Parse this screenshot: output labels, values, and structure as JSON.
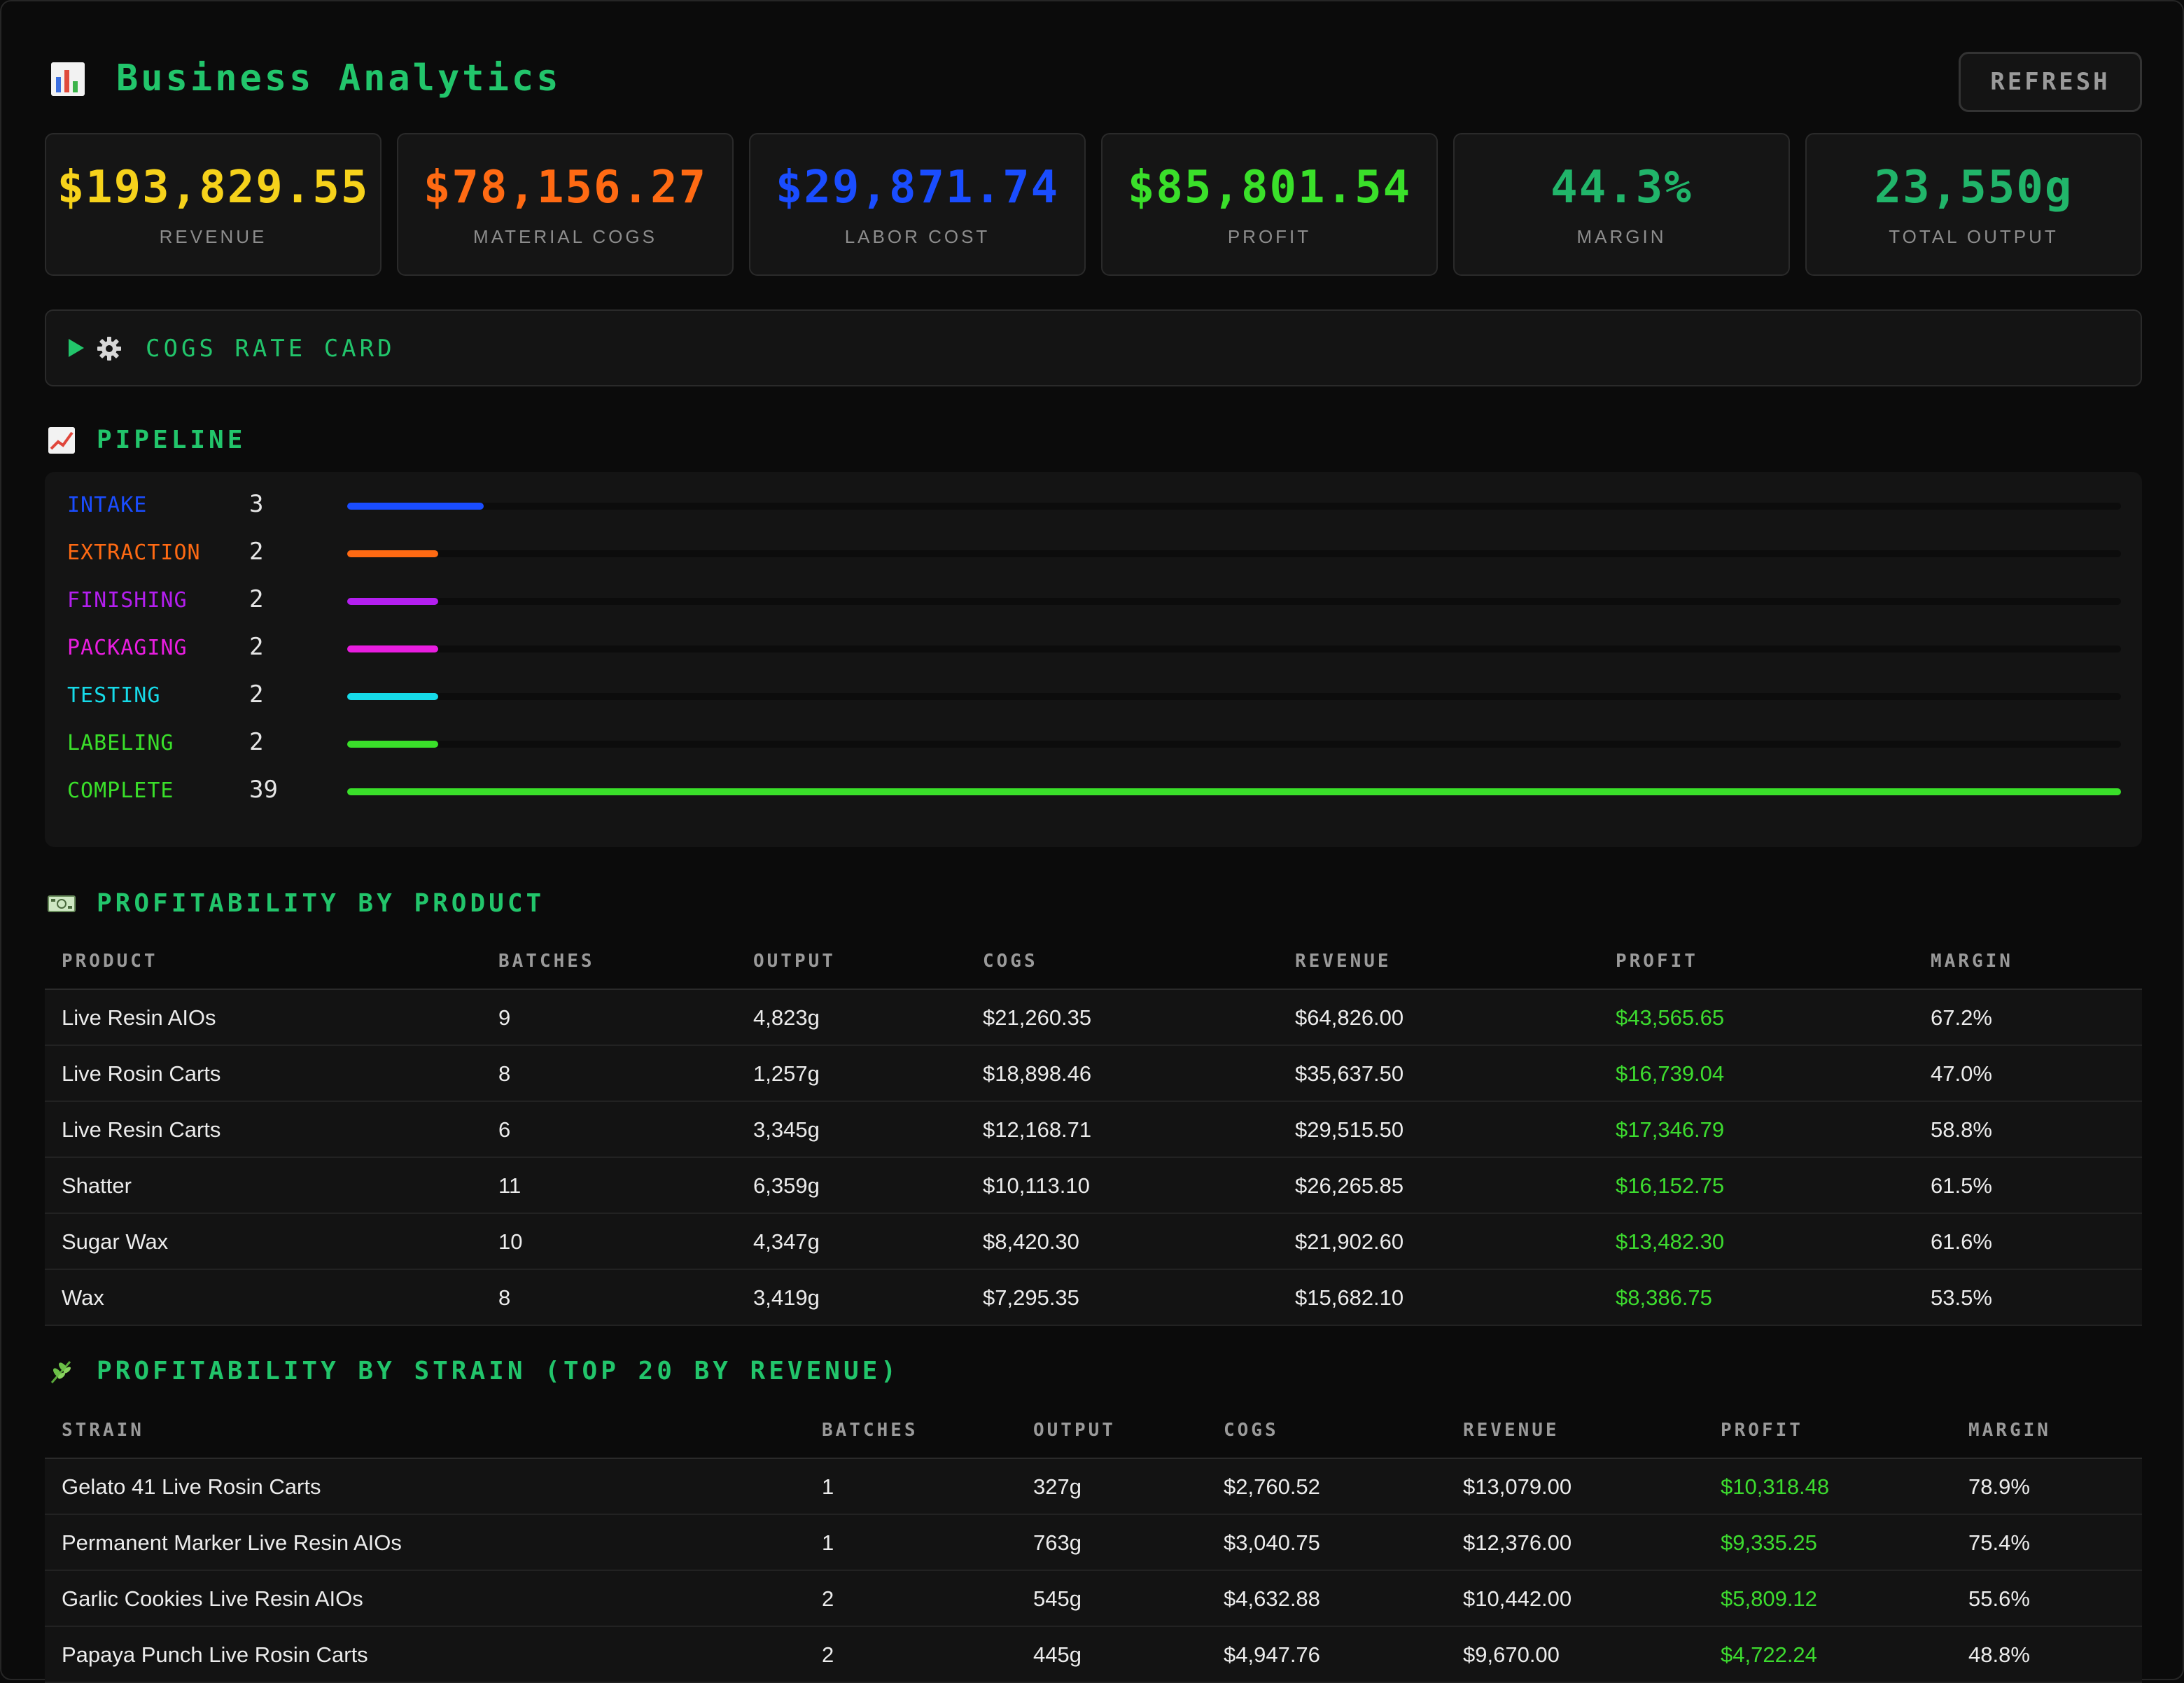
{
  "app": {
    "title": "Business Analytics",
    "title_icon": "bar-chart-icon",
    "refresh_label": "REFRESH"
  },
  "kpis": [
    {
      "value": "$193,829.55",
      "label": "REVENUE",
      "color": "#f6d21b"
    },
    {
      "value": "$78,156.27",
      "label": "MATERIAL COGS",
      "color": "#ff6a13"
    },
    {
      "value": "$29,871.74",
      "label": "LABOR COST",
      "color": "#1a4dff"
    },
    {
      "value": "$85,801.54",
      "label": "PROFIT",
      "color": "#3ae02a"
    },
    {
      "value": "44.3%",
      "label": "MARGIN",
      "color": "#21b56a"
    },
    {
      "value": "23,550g",
      "label": "TOTAL OUTPUT",
      "color": "#21b56a"
    }
  ],
  "cogs_rate_card": {
    "label": "COGS RATE CARD",
    "icon": "gear-icon",
    "expanded": false
  },
  "pipeline": {
    "title": "PIPELINE",
    "icon": "trend-chart-icon",
    "max": 39,
    "stages": [
      {
        "name": "INTAKE",
        "count": 3,
        "color": "#1a4dff"
      },
      {
        "name": "EXTRACTION",
        "count": 2,
        "color": "#ff6a13"
      },
      {
        "name": "FINISHING",
        "count": 2,
        "color": "#b41ff0"
      },
      {
        "name": "PACKAGING",
        "count": 2,
        "color": "#e81ddf"
      },
      {
        "name": "TESTING",
        "count": 2,
        "color": "#16dbe9"
      },
      {
        "name": "LABELING",
        "count": 2,
        "color": "#3ae02a"
      },
      {
        "name": "COMPLETE",
        "count": 39,
        "color": "#3ae02a"
      }
    ]
  },
  "by_product": {
    "title": "PROFITABILITY BY PRODUCT",
    "icon": "money-icon",
    "headers": [
      "PRODUCT",
      "BATCHES",
      "OUTPUT",
      "COGS",
      "REVENUE",
      "PROFIT",
      "MARGIN"
    ],
    "rows": [
      [
        "Live Resin AIOs",
        "9",
        "4,823g",
        "$21,260.35",
        "$64,826.00",
        "$43,565.65",
        "67.2%"
      ],
      [
        "Live Rosin Carts",
        "8",
        "1,257g",
        "$18,898.46",
        "$35,637.50",
        "$16,739.04",
        "47.0%"
      ],
      [
        "Live Resin Carts",
        "6",
        "3,345g",
        "$12,168.71",
        "$29,515.50",
        "$17,346.79",
        "58.8%"
      ],
      [
        "Shatter",
        "11",
        "6,359g",
        "$10,113.10",
        "$26,265.85",
        "$16,152.75",
        "61.5%"
      ],
      [
        "Sugar Wax",
        "10",
        "4,347g",
        "$8,420.30",
        "$21,902.60",
        "$13,482.30",
        "61.6%"
      ],
      [
        "Wax",
        "8",
        "3,419g",
        "$7,295.35",
        "$15,682.10",
        "$8,386.75",
        "53.5%"
      ]
    ]
  },
  "by_strain": {
    "title": "PROFITABILITY BY STRAIN (TOP 20 BY REVENUE)",
    "icon": "herb-icon",
    "headers": [
      "STRAIN",
      "BATCHES",
      "OUTPUT",
      "COGS",
      "REVENUE",
      "PROFIT",
      "MARGIN"
    ],
    "rows": [
      [
        "Gelato 41 Live Rosin Carts",
        "1",
        "327g",
        "$2,760.52",
        "$13,079.00",
        "$10,318.48",
        "78.9%"
      ],
      [
        "Permanent Marker Live Resin AIOs",
        "1",
        "763g",
        "$3,040.75",
        "$12,376.00",
        "$9,335.25",
        "75.4%"
      ],
      [
        "Garlic Cookies Live Resin AIOs",
        "2",
        "545g",
        "$4,632.88",
        "$10,442.00",
        "$5,809.12",
        "55.6%"
      ],
      [
        "Papaya Punch Live Rosin Carts",
        "2",
        "445g",
        "$4,947.76",
        "$9,670.00",
        "$4,722.24",
        "48.8%"
      ]
    ]
  }
}
